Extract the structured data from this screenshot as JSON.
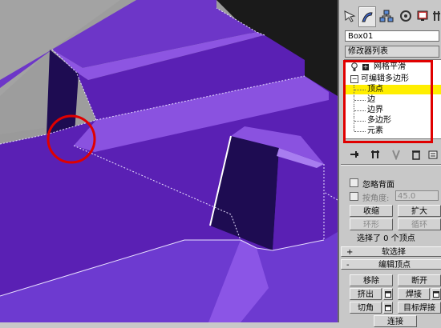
{
  "toolbar": {
    "tabs": [
      {
        "icon": "create-arrow-icon"
      },
      {
        "icon": "modify-icon"
      },
      {
        "icon": "hierarchy-icon"
      },
      {
        "icon": "motion-icon"
      },
      {
        "icon": "display-icon"
      },
      {
        "icon": "utilities-icon"
      }
    ]
  },
  "object_name": "Box01",
  "modifier_list_label": "修改器列表",
  "stack": {
    "items": [
      {
        "label": "网格平滑",
        "prefix": "+"
      },
      {
        "label": "可编辑多边形",
        "prefix": "−"
      }
    ],
    "subobjects": [
      "顶点",
      "边",
      "边界",
      "多边形",
      "元素"
    ],
    "selected": "顶点"
  },
  "stack_toolbar_icons": [
    "pin-stack-icon",
    "show-end-result-icon",
    "make-unique-icon",
    "remove-modifier-icon",
    "configure-sets-icon"
  ],
  "selection": {
    "ignore_backfacing_label": "忽略背面",
    "by_angle_label": "按角度:",
    "by_angle_value": "45.0",
    "shrink": "收缩",
    "grow": "扩大",
    "ring": "环形",
    "loop": "循环",
    "status": "选择了 0 个顶点"
  },
  "soft_selection": {
    "toggle": "+",
    "label": "软选择"
  },
  "edit_vertices": {
    "toggle": "-",
    "label": "编辑顶点",
    "remove": "移除",
    "break": "断开",
    "extrude": "挤出",
    "weld": "焊接",
    "chamfer": "切角",
    "target_weld": "目标焊接",
    "connect": "连接"
  },
  "colors": {
    "model_face": "#5a20b4",
    "model_highlight": "#8f5ae6",
    "model_shadow": "#1e0c52",
    "highlight_box": "#e00000",
    "stack_selected": "#ffee00"
  }
}
